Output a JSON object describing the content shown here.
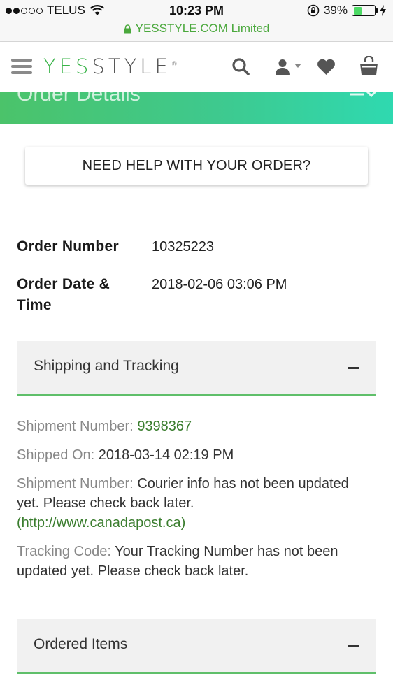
{
  "status_bar": {
    "carrier": "TELUS",
    "time": "10:23 PM",
    "battery_percent": "39%",
    "battery_level": 0.39
  },
  "url_bar": {
    "site": "YESSTYLE.COM Limited"
  },
  "header": {
    "logo_prefix": "YES",
    "logo_suffix": "STYLE",
    "icons": [
      "menu-icon",
      "search-icon",
      "user-icon",
      "heart-icon",
      "shopping-bag-icon"
    ]
  },
  "banner": {
    "title": "Order Details"
  },
  "help_button": {
    "label": "NEED HELP WITH YOUR ORDER?"
  },
  "order": {
    "number_label": "Order Number",
    "number_value": "10325223",
    "date_label_line1": "Order Date &",
    "date_label_line2": "Time",
    "date_value": "2018-02-06 03:06 PM"
  },
  "shipping_section": {
    "title": "Shipping and Tracking",
    "shipment_number_label": "Shipment Number:",
    "shipment_number_value": "9398367",
    "shipped_on_label": "Shipped On:",
    "shipped_on_value": "2018-03-14 02:19 PM",
    "courier_label": "Shipment Number:",
    "courier_text_line1": "Courier info has not been updated",
    "courier_text_line2": "yet. Please check back later.",
    "courier_link": "(http://www.canadapost.ca)",
    "tracking_label": "Tracking Code:",
    "tracking_text_line1": "Your Tracking Number has not been",
    "tracking_text_line2": "updated yet. Please check back later."
  },
  "ordered_items_section": {
    "title": "Ordered Items"
  },
  "colors": {
    "brand_green": "#3bb44a",
    "link_green": "#3a7d2e",
    "accordion_underline": "#5fbf6a"
  }
}
